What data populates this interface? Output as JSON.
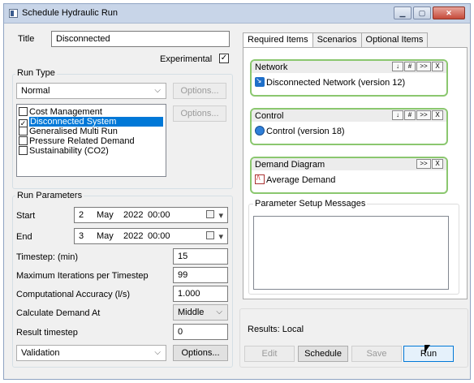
{
  "window": {
    "title": "Schedule Hydraulic Run"
  },
  "form": {
    "title_label": "Title",
    "title_value": "Disconnected",
    "experimental_label": "Experimental",
    "experimental_check": "✓",
    "run_type_group": "Run Type",
    "run_type_value": "Normal",
    "options_label": "Options...",
    "run_type_items": [
      {
        "label": "Cost Management",
        "mark": ""
      },
      {
        "label": "Disconnected System",
        "mark": "✓"
      },
      {
        "label": "Generalised Multi Run",
        "mark": ""
      },
      {
        "label": "Pressure Related Demand",
        "mark": ""
      },
      {
        "label": "Sustainability (CO2)",
        "mark": ""
      }
    ],
    "run_params_group": "Run Parameters",
    "start_label": "Start",
    "start": {
      "day": "2",
      "month": "May",
      "year": "2022",
      "time": "00:00"
    },
    "end_label": "End",
    "end": {
      "day": "3",
      "month": "May",
      "year": "2022",
      "time": "00:00"
    },
    "timestep_label": "Timestep: (min)",
    "timestep_value": "15",
    "max_iter_label": "Maximum Iterations per Timestep",
    "max_iter_value": "99",
    "accuracy_label": "Computational Accuracy (l/s)",
    "accuracy_value": "1.000",
    "calc_demand_label": "Calculate Demand At",
    "calc_demand_value": "Middle",
    "result_timestep_label": "Result timestep",
    "result_timestep_value": "0",
    "validation_value": "Validation",
    "validation_options_label": "Options..."
  },
  "tabs": [
    "Required Items",
    "Scenarios",
    "Optional Items"
  ],
  "cards": {
    "network": {
      "label": "Network",
      "item": "Disconnected Network (version 12)",
      "buttons": [
        "↓",
        "#",
        ">>",
        "X"
      ]
    },
    "control": {
      "label": "Control",
      "item": "Control (version 18)",
      "buttons": [
        "↓",
        "#",
        ">>",
        "X"
      ]
    },
    "demand": {
      "label": "Demand Diagram",
      "item": "Average Demand",
      "buttons": [
        ">>",
        "X"
      ]
    }
  },
  "messages_label": "Parameter Setup Messages",
  "results_label": "Results: Local",
  "buttons": {
    "edit": "Edit",
    "schedule": "Schedule",
    "save": "Save",
    "run": "Run"
  },
  "icons": [
    "app-icon",
    "minimize-icon",
    "maximize-icon",
    "close-icon",
    "chevron-down-icon",
    "calendar-icon",
    "network-icon",
    "control-icon",
    "demand-diagram-icon",
    "mouse-cursor-icon"
  ]
}
